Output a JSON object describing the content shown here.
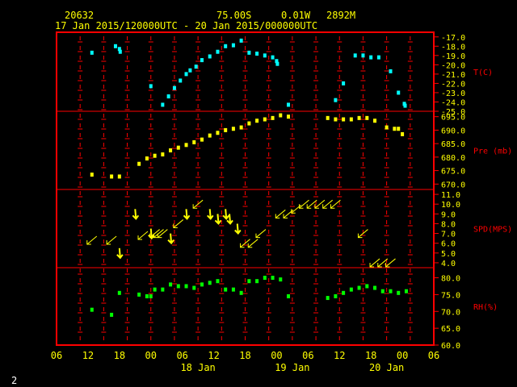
{
  "header": {
    "station_id": "20632",
    "latitude": "75.00S",
    "longitude": "0.01W",
    "elevation": "2892M",
    "time_range": "17 Jan 2015/120000UTC - 20 Jan 2015/000000UTC",
    "page_number": "2"
  },
  "colors": {
    "frame": "#ff0000",
    "text": "#ffff00",
    "temperature": "#00ffff",
    "pressure": "#ffff00",
    "wind": "#ffff00",
    "humidity": "#00ff00",
    "page_number": "#ffffff"
  },
  "chart_data": {
    "type": "scatter",
    "x_axis": {
      "range_hours": [
        0,
        72
      ],
      "tick_labels": [
        "06",
        "12",
        "18",
        "00",
        "06",
        "12",
        "18",
        "00",
        "06",
        "12",
        "18",
        "00",
        "06"
      ],
      "day_labels": [
        "18 Jan",
        "19 Jan",
        "20 Jan"
      ]
    },
    "panels": [
      {
        "id": "temperature",
        "label": "T(C)",
        "ylim": [
          -25.0,
          -16.5
        ],
        "tick_labels": [
          "-17.0",
          "-18.0",
          "-19.0",
          "-20.0",
          "-21.0",
          "-22.0",
          "-23.0",
          "-24.0",
          "-25.0"
        ],
        "tick_values": [
          -17,
          -18,
          -19,
          -20,
          -21,
          -22,
          -23,
          -24,
          -25
        ],
        "points": [
          [
            9,
            -18.7
          ],
          [
            15,
            -18.0
          ],
          [
            16,
            -18.3
          ],
          [
            16.2,
            -18.6
          ],
          [
            24,
            -22.3
          ],
          [
            27,
            -24.3
          ],
          [
            28.5,
            -23.4
          ],
          [
            30,
            -22.5
          ],
          [
            31.5,
            -21.7
          ],
          [
            33,
            -21.0
          ],
          [
            34,
            -20.6
          ],
          [
            35.5,
            -20.2
          ],
          [
            37,
            -19.5
          ],
          [
            39,
            -19.1
          ],
          [
            41,
            -18.6
          ],
          [
            43,
            -18.0
          ],
          [
            45,
            -17.9
          ],
          [
            47,
            -17.4
          ],
          [
            49,
            -18.7
          ],
          [
            51,
            -18.8
          ],
          [
            53,
            -19.0
          ],
          [
            55,
            -19.2
          ],
          [
            56,
            -19.6
          ],
          [
            56.2,
            -19.9
          ],
          [
            59,
            -24.3
          ],
          [
            71,
            -23.8
          ],
          [
            73,
            -22.0
          ],
          [
            76,
            -19.0
          ],
          [
            78,
            -19.0
          ],
          [
            80,
            -19.2
          ],
          [
            82,
            -19.2
          ],
          [
            85,
            -20.7
          ],
          [
            87,
            -23.0
          ],
          [
            88.5,
            -24.2
          ],
          [
            88.7,
            -24.4
          ]
        ]
      },
      {
        "id": "pressure",
        "label": "Pre (mb)",
        "ylim": [
          668.0,
          697.0
        ],
        "tick_labels": [
          "695.0",
          "690.0",
          "685.0",
          "680.0",
          "675.0",
          "670.0"
        ],
        "tick_values": [
          695,
          690,
          685,
          680,
          675,
          670
        ],
        "points": [
          [
            9,
            673.5
          ],
          [
            14,
            672.8
          ],
          [
            16,
            672.8
          ],
          [
            21,
            677.5
          ],
          [
            23,
            679.5
          ],
          [
            25,
            680.5
          ],
          [
            27,
            681.0
          ],
          [
            29,
            682.5
          ],
          [
            31,
            683.5
          ],
          [
            33,
            684.5
          ],
          [
            35,
            685.5
          ],
          [
            37,
            686.5
          ],
          [
            39,
            688.0
          ],
          [
            41,
            689.0
          ],
          [
            43,
            690.0
          ],
          [
            45,
            690.5
          ],
          [
            47,
            691.0
          ],
          [
            49,
            692.5
          ],
          [
            51,
            693.5
          ],
          [
            53,
            694.0
          ],
          [
            55,
            694.5
          ],
          [
            57,
            695.5
          ],
          [
            59,
            695.0
          ],
          [
            69,
            694.5
          ],
          [
            71,
            694.0
          ],
          [
            73,
            694.0
          ],
          [
            75,
            694.0
          ],
          [
            77,
            694.5
          ],
          [
            79,
            694.5
          ],
          [
            81,
            693.5
          ],
          [
            84,
            691.0
          ],
          [
            86,
            690.5
          ],
          [
            87,
            690.5
          ],
          [
            88,
            688.5
          ]
        ]
      },
      {
        "id": "wind",
        "label": "SPD(MPS)",
        "ylim": [
          3.5,
          11.5
        ],
        "tick_labels": [
          "11.0",
          "10.0",
          "9.0",
          "8.0",
          "7.0",
          "6.0",
          "5.0",
          "4.0"
        ],
        "tick_values": [
          11,
          10,
          9,
          8,
          7,
          6,
          5,
          4
        ],
        "arrows": [
          {
            "t": 9,
            "spd": 6.3,
            "dir": "sw"
          },
          {
            "t": 14,
            "spd": 6.3,
            "dir": "sw"
          },
          {
            "t": 16,
            "spd": 5.0,
            "dir": "s"
          },
          {
            "t": 20,
            "spd": 9.0,
            "dir": "s"
          },
          {
            "t": 22,
            "spd": 6.8,
            "dir": "sw"
          },
          {
            "t": 24,
            "spd": 7.0,
            "dir": "s"
          },
          {
            "t": 25,
            "spd": 7.0,
            "dir": "sw"
          },
          {
            "t": 26,
            "spd": 7.0,
            "dir": "sw"
          },
          {
            "t": 27,
            "spd": 7.0,
            "dir": "sw"
          },
          {
            "t": 29,
            "spd": 6.5,
            "dir": "s"
          },
          {
            "t": 31,
            "spd": 8.0,
            "dir": "sw"
          },
          {
            "t": 33,
            "spd": 9.0,
            "dir": "s"
          },
          {
            "t": 36,
            "spd": 10.0,
            "dir": "sw"
          },
          {
            "t": 39,
            "spd": 9.0,
            "dir": "s"
          },
          {
            "t": 41,
            "spd": 8.5,
            "dir": "s"
          },
          {
            "t": 43,
            "spd": 9.0,
            "dir": "s"
          },
          {
            "t": 44,
            "spd": 8.5,
            "dir": "s"
          },
          {
            "t": 46,
            "spd": 7.5,
            "dir": "s"
          },
          {
            "t": 48,
            "spd": 6.0,
            "dir": "sw"
          },
          {
            "t": 50,
            "spd": 6.0,
            "dir": "sw"
          },
          {
            "t": 52,
            "spd": 7.0,
            "dir": "sw"
          },
          {
            "t": 57,
            "spd": 9.0,
            "dir": "sw"
          },
          {
            "t": 59,
            "spd": 9.0,
            "dir": "sw"
          },
          {
            "t": 61,
            "spd": 9.5,
            "dir": "sw"
          },
          {
            "t": 63,
            "spd": 10.0,
            "dir": "sw"
          },
          {
            "t": 65,
            "spd": 10.0,
            "dir": "sw"
          },
          {
            "t": 67,
            "spd": 10.0,
            "dir": "sw"
          },
          {
            "t": 69,
            "spd": 10.0,
            "dir": "sw"
          },
          {
            "t": 71,
            "spd": 10.0,
            "dir": "sw"
          },
          {
            "t": 78,
            "spd": 7.0,
            "dir": "sw"
          },
          {
            "t": 81,
            "spd": 4.0,
            "dir": "sw"
          },
          {
            "t": 83,
            "spd": 4.0,
            "dir": "sw"
          },
          {
            "t": 85,
            "spd": 4.0,
            "dir": "sw"
          }
        ]
      },
      {
        "id": "humidity",
        "label": "RH(%)",
        "ylim": [
          60.0,
          83.0
        ],
        "tick_labels": [
          "80.0",
          "75.0",
          "70.0",
          "65.0",
          "60.0"
        ],
        "tick_values": [
          80,
          75,
          70,
          65,
          60
        ],
        "points": [
          [
            9,
            70.5
          ],
          [
            14,
            69.0
          ],
          [
            16,
            75.5
          ],
          [
            21,
            75.0
          ],
          [
            23,
            74.5
          ],
          [
            24,
            74.5
          ],
          [
            25,
            76.5
          ],
          [
            27,
            76.5
          ],
          [
            29,
            78.0
          ],
          [
            31,
            77.5
          ],
          [
            33,
            77.5
          ],
          [
            35,
            77.0
          ],
          [
            37,
            78.0
          ],
          [
            39,
            78.5
          ],
          [
            41,
            79.0
          ],
          [
            43,
            76.5
          ],
          [
            45,
            76.5
          ],
          [
            47,
            75.5
          ],
          [
            49,
            79.0
          ],
          [
            51,
            79.0
          ],
          [
            53,
            80.0
          ],
          [
            55,
            80.0
          ],
          [
            57,
            79.5
          ],
          [
            59,
            74.5
          ],
          [
            69,
            74.0
          ],
          [
            71,
            74.5
          ],
          [
            73,
            75.5
          ],
          [
            75,
            76.5
          ],
          [
            77,
            77.0
          ],
          [
            79,
            77.5
          ],
          [
            81,
            77.0
          ],
          [
            83,
            76.0
          ],
          [
            85,
            76.0
          ],
          [
            87,
            75.5
          ],
          [
            89,
            76.0
          ]
        ]
      }
    ]
  }
}
